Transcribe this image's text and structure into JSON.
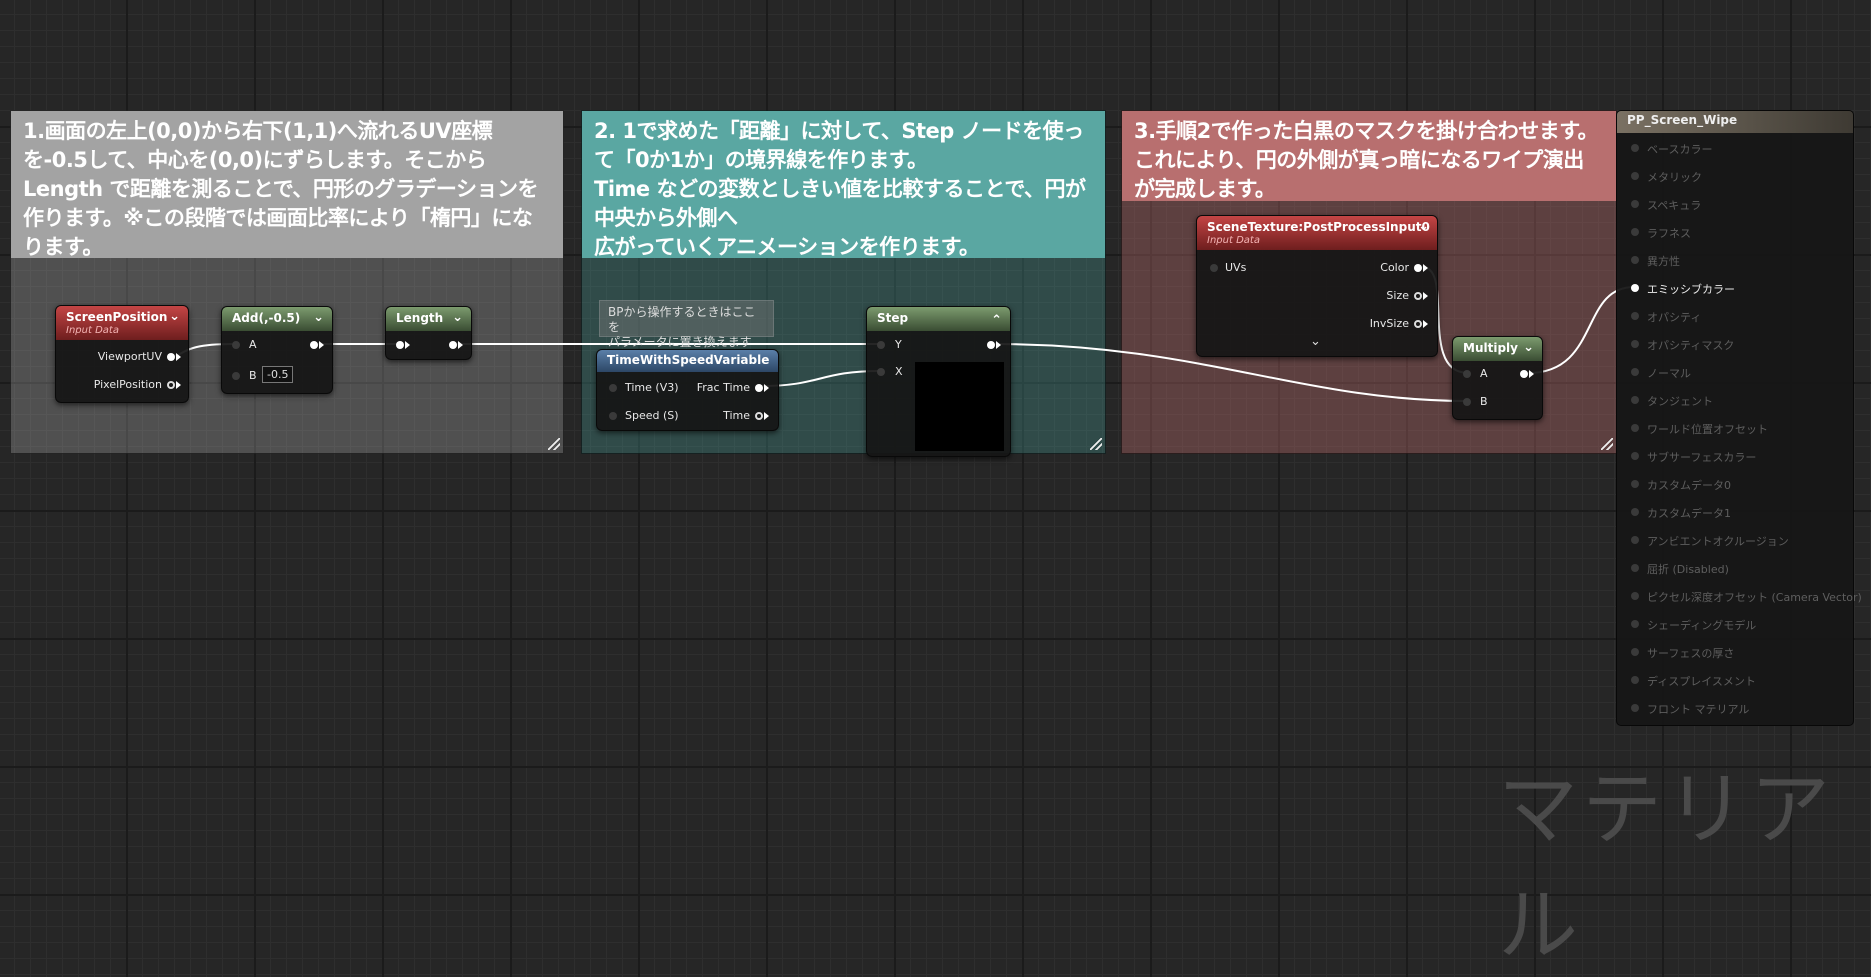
{
  "comments": [
    {
      "text": "1.画面の左上(0,0)から右下(1,1)へ流れるUV座標を-0.5して、中心を(0,0)にずらします。そこからLength で距離を測ることで、円形のグラデーションを作ります。※この段階では画面比率により「楕円」になります。",
      "color": "#a3a3a3"
    },
    {
      "text": "2. 1で求めた「距離」に対して、Step ノードを使って「0か1か」の境界線を作ります。\n Time などの変数としきい値を比較することで、円が中央から外側へ\n広がっていくアニメーションを作ります。",
      "color": "#5aa7a2"
    },
    {
      "text": "3.手順2で作った白黒のマスクを掛け合わせます。これにより、円の外側が真っ暗になるワイプ演出が完成します。",
      "color": "#b86f6f"
    }
  ],
  "nodes": {
    "screen_position": {
      "title": "ScreenPosition",
      "subtitle": "Input Data",
      "pins": {
        "viewport_uv": "ViewportUV",
        "pixel_position": "PixelPosition"
      }
    },
    "add": {
      "title": "Add(,-0.5)",
      "pins": {
        "a": "A",
        "b": "B"
      },
      "b_value": "-0.5"
    },
    "length": {
      "title": "Length"
    },
    "time_with_speed": {
      "title": "TimeWithSpeedVariable",
      "pins": {
        "time_v3": "Time (V3)",
        "speed": "Speed (S)",
        "frac_time": "Frac Time",
        "time": "Time"
      }
    },
    "step": {
      "title": "Step",
      "pins": {
        "y": "Y",
        "x": "X"
      }
    },
    "scene_texture": {
      "title": "SceneTexture:PostProcessInput0",
      "subtitle": "Input Data",
      "pins": {
        "uvs": "UVs",
        "color": "Color",
        "size": "Size",
        "inv_size": "InvSize"
      }
    },
    "multiply": {
      "title": "Multiply",
      "pins": {
        "a": "A",
        "b": "B"
      }
    }
  },
  "note": "BPから操作するときはここを\nパラメータに置き換えます",
  "output_node": {
    "title": "PP_Screen_Wipe",
    "pins": [
      {
        "label": "ベースカラー",
        "active": false
      },
      {
        "label": "メタリック",
        "active": false
      },
      {
        "label": "スペキュラ",
        "active": false
      },
      {
        "label": "ラフネス",
        "active": false
      },
      {
        "label": "異方性",
        "active": false
      },
      {
        "label": "エミッシブカラー",
        "active": true
      },
      {
        "label": "オパシティ",
        "active": false
      },
      {
        "label": "オパシティマスク",
        "active": false
      },
      {
        "label": "ノーマル",
        "active": false
      },
      {
        "label": "タンジェント",
        "active": false
      },
      {
        "label": "ワールド位置オフセット",
        "active": false
      },
      {
        "label": "サブサーフェスカラー",
        "active": false
      },
      {
        "label": "カスタムデータ0",
        "active": false
      },
      {
        "label": "カスタムデータ1",
        "active": false
      },
      {
        "label": "アンビエントオクルージョン",
        "active": false
      },
      {
        "label": "屈折 (Disabled)",
        "active": false
      },
      {
        "label": "ピクセル深度オフセット (Camera Vector)",
        "active": false
      },
      {
        "label": "シェーディングモデル",
        "active": false
      },
      {
        "label": "サーフェスの厚さ",
        "active": false
      },
      {
        "label": "ディスプレイスメント",
        "active": false
      },
      {
        "label": "フロント マテリアル",
        "active": false
      }
    ]
  },
  "watermark": "マテリアル"
}
